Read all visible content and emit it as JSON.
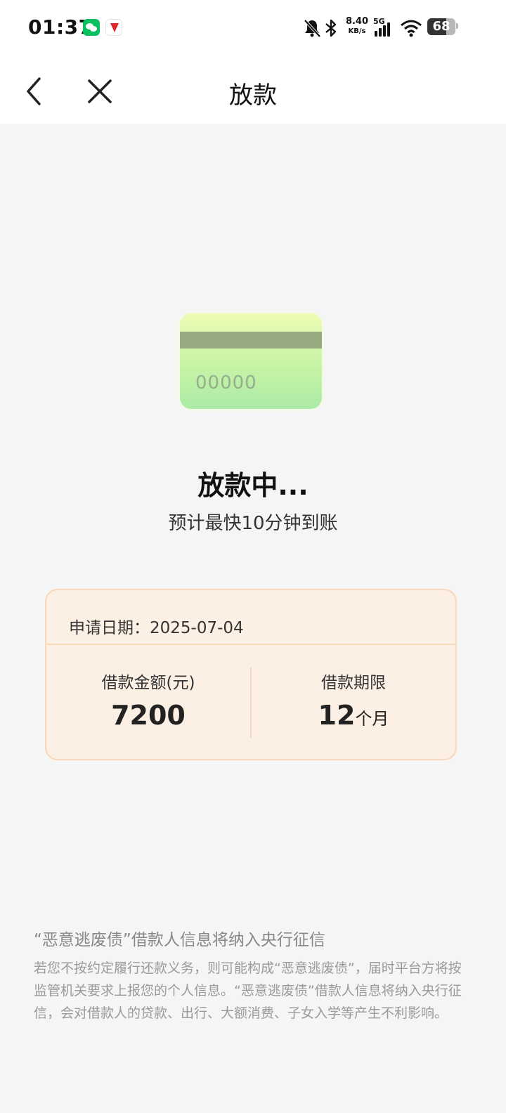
{
  "status_bar": {
    "time": "01:37",
    "net_speed_value": "8.40",
    "net_speed_unit": "KB/s",
    "network_type": "5G",
    "battery_level": "68"
  },
  "nav": {
    "title": "放款"
  },
  "illustration": {
    "card_number": "00000"
  },
  "status": {
    "title": "放款中...",
    "subtitle": "预计最快10分钟到账"
  },
  "loan_info": {
    "apply_date": "申请日期：2025-07-04",
    "amount_label": "借款金额(元)",
    "amount_value": "7200",
    "term_label": "借款期限",
    "term_value": "12",
    "term_unit": "个月"
  },
  "notice": {
    "title": "“恶意逃废债”借款人信息将纳入央行征信",
    "body": "若您不按约定履行还款义务，则可能构成“恶意逃废债”，届时平台方将按监管机关要求上报您的个人信息。“恶意逃废债”借款人信息将纳入央行征信，会对借款人的贷款、出行、大额消费、子女入学等产生不利影响。"
  },
  "colors": {
    "panel_bg": "#fcefe4",
    "panel_border": "#f7d8bd",
    "page_bg": "#f5f5f5"
  }
}
